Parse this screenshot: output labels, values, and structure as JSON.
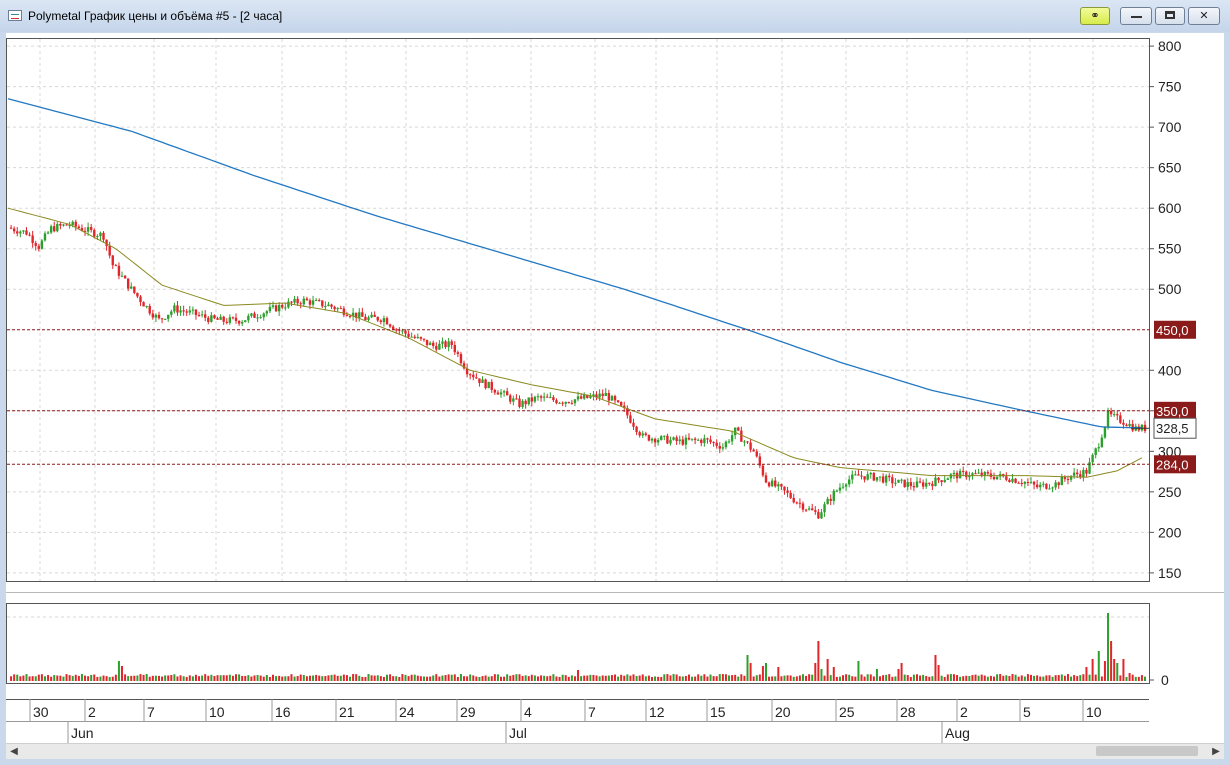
{
  "window": {
    "title": "Polymetal График цены и объёма #5 - [2 часа]",
    "buttons": {
      "link": "link-icon",
      "minimize": "minimize-icon",
      "maximize": "maximize-icon",
      "close": "close-icon"
    }
  },
  "chart_data": {
    "type": "candlestick",
    "price_axis": {
      "ticks": [
        800,
        750,
        700,
        650,
        600,
        550,
        500,
        400,
        350,
        300,
        250,
        200,
        150
      ],
      "range": [
        140,
        810
      ]
    },
    "horizontal_lines": [
      {
        "value": 450,
        "label": "450,0",
        "color": "#8b1a1a"
      },
      {
        "value": 350,
        "label": "350,0",
        "color": "#8b1a1a"
      },
      {
        "value": 284,
        "label": "284,0",
        "color": "#8b1a1a"
      }
    ],
    "last_price": {
      "value": 328.5,
      "label": "328,5"
    },
    "colors": {
      "up": "#2ca02c",
      "down": "#e0262b",
      "ma_long": "#2378c2",
      "ma_short": "#8a8a20",
      "grid": "#d8d8d8"
    },
    "close_anchors": [
      [
        0,
        576
      ],
      [
        6,
        570
      ],
      [
        10,
        553
      ],
      [
        14,
        575
      ],
      [
        20,
        580
      ],
      [
        26,
        572
      ],
      [
        31,
        566
      ],
      [
        34,
        530
      ],
      [
        40,
        500
      ],
      [
        45,
        478
      ],
      [
        49,
        462
      ],
      [
        54,
        476
      ],
      [
        60,
        470
      ],
      [
        66,
        463
      ],
      [
        70,
        461
      ],
      [
        76,
        462
      ],
      [
        84,
        473
      ],
      [
        90,
        481
      ],
      [
        96,
        486
      ],
      [
        104,
        480
      ],
      [
        110,
        472
      ],
      [
        116,
        464
      ],
      [
        122,
        464
      ],
      [
        126,
        451
      ],
      [
        132,
        440
      ],
      [
        138,
        430
      ],
      [
        144,
        432
      ],
      [
        149,
        400
      ],
      [
        154,
        385
      ],
      [
        160,
        372
      ],
      [
        166,
        358
      ],
      [
        172,
        366
      ],
      [
        180,
        362
      ],
      [
        188,
        366
      ],
      [
        194,
        370
      ],
      [
        200,
        350
      ],
      [
        206,
        318
      ],
      [
        212,
        315
      ],
      [
        218,
        312
      ],
      [
        226,
        314
      ],
      [
        232,
        306
      ],
      [
        236,
        325
      ],
      [
        242,
        300
      ],
      [
        246,
        264
      ],
      [
        252,
        250
      ],
      [
        256,
        238
      ],
      [
        260,
        228
      ],
      [
        263,
        222
      ],
      [
        268,
        248
      ],
      [
        272,
        264
      ],
      [
        276,
        270
      ],
      [
        282,
        268
      ],
      [
        288,
        262
      ],
      [
        294,
        258
      ],
      [
        300,
        262
      ],
      [
        306,
        270
      ],
      [
        312,
        272
      ],
      [
        318,
        270
      ],
      [
        324,
        268
      ],
      [
        330,
        262
      ],
      [
        334,
        256
      ],
      [
        340,
        260
      ],
      [
        345,
        270
      ],
      [
        350,
        275
      ],
      [
        354,
        310
      ],
      [
        357,
        345
      ],
      [
        360,
        340
      ],
      [
        363,
        335
      ],
      [
        366,
        328
      ],
      [
        368,
        328.5
      ]
    ],
    "ma_long": [
      [
        0,
        735
      ],
      [
        40,
        695
      ],
      [
        80,
        640
      ],
      [
        120,
        590
      ],
      [
        160,
        545
      ],
      [
        200,
        500
      ],
      [
        240,
        450
      ],
      [
        270,
        410
      ],
      [
        300,
        375
      ],
      [
        330,
        350
      ],
      [
        355,
        330
      ],
      [
        368,
        329
      ]
    ],
    "ma_short": [
      [
        0,
        600
      ],
      [
        20,
        580
      ],
      [
        35,
        550
      ],
      [
        50,
        505
      ],
      [
        70,
        480
      ],
      [
        90,
        483
      ],
      [
        110,
        470
      ],
      [
        130,
        440
      ],
      [
        150,
        400
      ],
      [
        170,
        382
      ],
      [
        190,
        368
      ],
      [
        210,
        340
      ],
      [
        235,
        325
      ],
      [
        255,
        292
      ],
      [
        270,
        280
      ],
      [
        300,
        270
      ],
      [
        330,
        270
      ],
      [
        350,
        268
      ],
      [
        360,
        276
      ],
      [
        368,
        292
      ]
    ],
    "volume_axis": {
      "ticks": [
        0
      ],
      "label": "0"
    },
    "volume": {
      "baseline": 4,
      "spikes": [
        [
          36,
          20
        ],
        [
          37,
          15
        ],
        [
          185,
          11
        ],
        [
          240,
          26
        ],
        [
          241,
          18
        ],
        [
          245,
          15
        ],
        [
          246,
          18
        ],
        [
          250,
          14
        ],
        [
          262,
          18
        ],
        [
          263,
          40
        ],
        [
          264,
          12
        ],
        [
          266,
          22
        ],
        [
          268,
          14
        ],
        [
          276,
          20
        ],
        [
          282,
          12
        ],
        [
          289,
          12
        ],
        [
          290,
          18
        ],
        [
          301,
          26
        ],
        [
          302,
          16
        ],
        [
          350,
          14
        ],
        [
          352,
          22
        ],
        [
          354,
          30
        ],
        [
          356,
          20
        ],
        [
          357,
          68
        ],
        [
          358,
          40
        ],
        [
          359,
          22
        ],
        [
          360,
          18
        ],
        [
          362,
          22
        ],
        [
          364,
          8
        ]
      ]
    },
    "date_axis": {
      "days": [
        "30",
        "2",
        "7",
        "10",
        "16",
        "21",
        "24",
        "29",
        "4",
        "7",
        "12",
        "15",
        "20",
        "25",
        "28",
        "2",
        "5",
        "10"
      ],
      "months": [
        "Jun",
        "Jul",
        "Aug"
      ]
    }
  }
}
